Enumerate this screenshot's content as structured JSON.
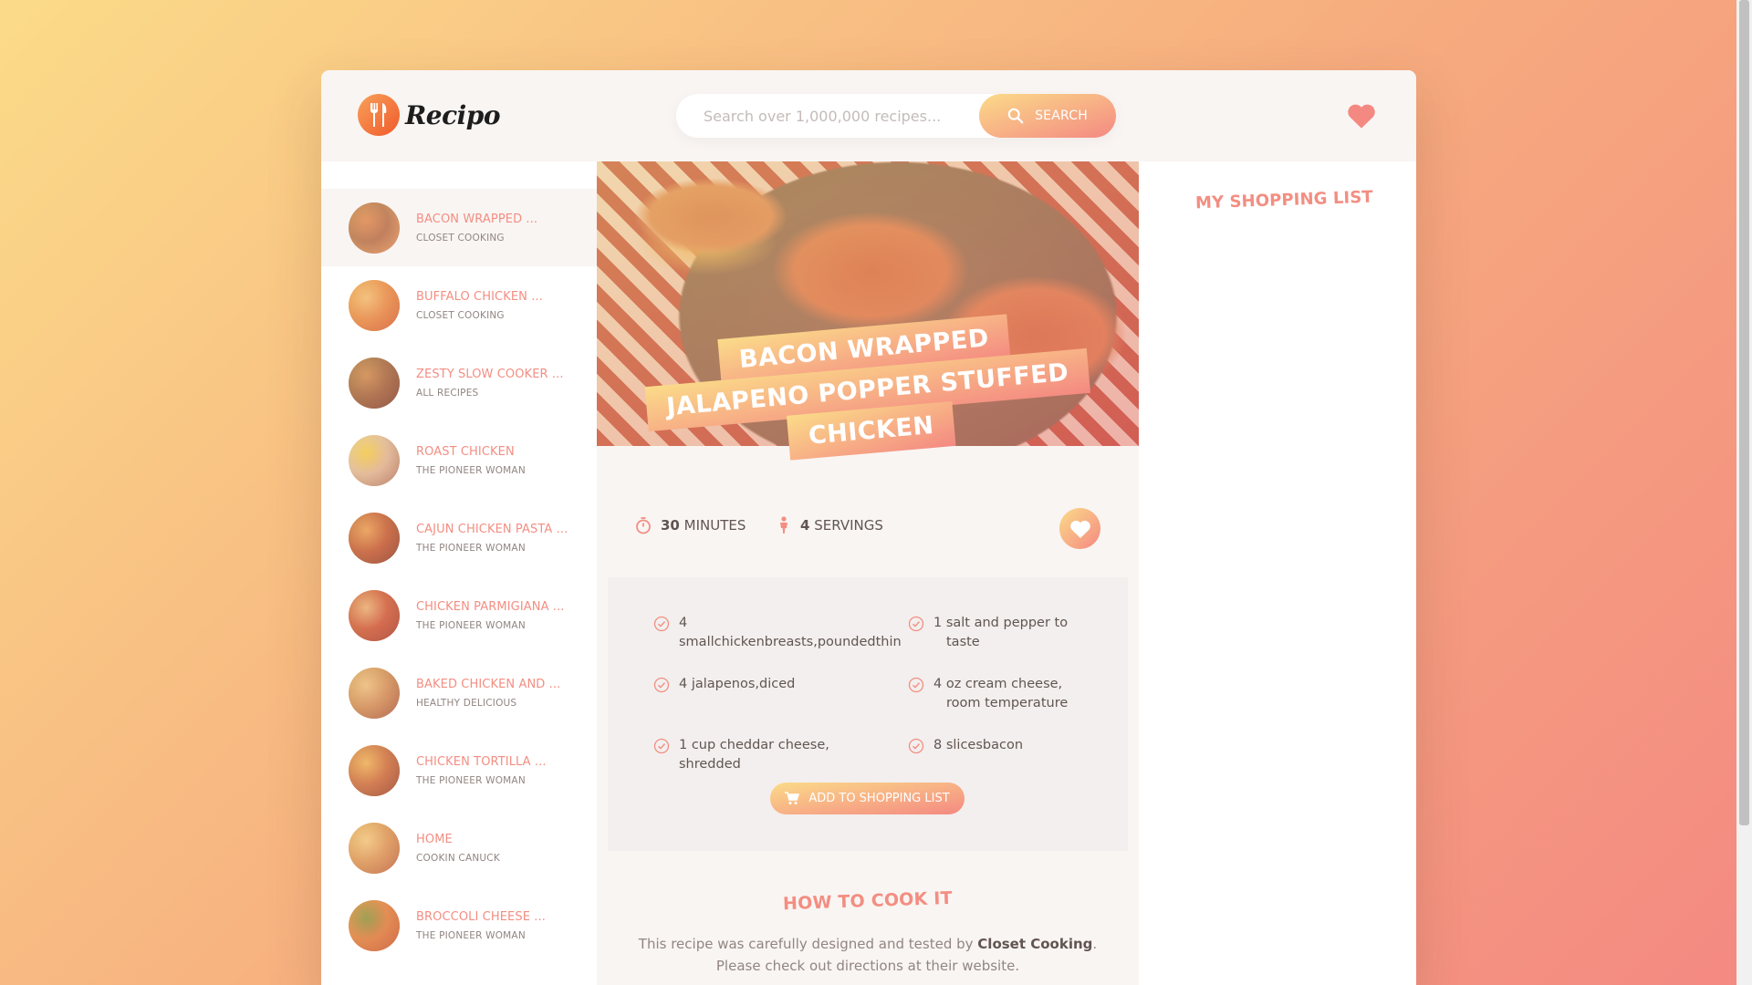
{
  "header": {
    "logo_text": "Recipo",
    "search_placeholder": "Search over 1,000,000 recipes...",
    "search_button": "SEARCH"
  },
  "results": [
    {
      "title": "BACON WRAPPED ...",
      "publisher": "CLOSET COOKING",
      "active": true,
      "colors": [
        "#a46a4a",
        "#d88252",
        "#e6b465"
      ]
    },
    {
      "title": "BUFFALO CHICKEN ...",
      "publisher": "CLOSET COOKING",
      "active": false,
      "colors": [
        "#e38a43",
        "#f0c27a",
        "#c9622d"
      ]
    },
    {
      "title": "ZESTY SLOW COOKER ...",
      "publisher": "ALL RECIPES",
      "active": false,
      "colors": [
        "#8c5a3a",
        "#c2834f",
        "#5e3b29"
      ]
    },
    {
      "title": "ROAST CHICKEN",
      "publisher": "THE PIONEER WOMAN",
      "active": false,
      "colors": [
        "#d9c3a8",
        "#f2d64a",
        "#9b7a5c"
      ]
    },
    {
      "title": "CAJUN CHICKEN PASTA ...",
      "publisher": "THE PIONEER WOMAN",
      "active": false,
      "colors": [
        "#b5502e",
        "#e39a54",
        "#6b3822"
      ]
    },
    {
      "title": "CHICKEN PARMIGIANA ...",
      "publisher": "THE PIONEER WOMAN",
      "active": false,
      "colors": [
        "#c24d33",
        "#e5b07f",
        "#8c3b28"
      ]
    },
    {
      "title": "BAKED CHICKEN AND ...",
      "publisher": "HEALTHY DELICIOUS",
      "active": false,
      "colors": [
        "#c7905a",
        "#e8c58c",
        "#8d5a37"
      ]
    },
    {
      "title": "CHICKEN TORTILLA ...",
      "publisher": "THE PIONEER WOMAN",
      "active": false,
      "colors": [
        "#c0663a",
        "#ebb35a",
        "#7a3f25"
      ]
    },
    {
      "title": "HOME",
      "publisher": "COOKIN CANUCK",
      "active": false,
      "colors": [
        "#d49a5a",
        "#f0d08a",
        "#a9683c"
      ]
    },
    {
      "title": "BROCCOLI CHEESE ...",
      "publisher": "THE PIONEER WOMAN",
      "active": false,
      "colors": [
        "#d87a3a",
        "#6f8f3a",
        "#b95a2a"
      ]
    }
  ],
  "recipe": {
    "title_lines": [
      "BACON WRAPPED",
      "JALAPENO POPPER STUFFED",
      "CHICKEN"
    ],
    "minutes": "30",
    "minutes_label": "MINUTES",
    "servings": "4",
    "servings_label": "SERVINGS",
    "ingredients": [
      {
        "line1": "4 smallchickenbreasts,poundedthin",
        "line2": ""
      },
      {
        "line1": "1 salt and pepper to",
        "line2": "taste"
      },
      {
        "line1": "4 jalapenos,diced",
        "line2": ""
      },
      {
        "line1": "4 oz cream cheese,",
        "line2": "room temperature"
      },
      {
        "line1": "1 cup cheddar cheese, shredded",
        "line2": ""
      },
      {
        "line1": "8 slicesbacon",
        "line2": ""
      }
    ],
    "add_button": "ADD TO SHOPPING LIST",
    "directions_heading": "HOW TO COOK IT",
    "directions_text_1": "This recipe was carefully designed and tested by ",
    "directions_publisher": "Closet Cooking",
    "directions_text_2": ".",
    "directions_text_3": "Please check out directions at their website."
  },
  "shopping": {
    "heading": "MY SHOPPING LIST"
  },
  "colors": {
    "accent": "#f38e82",
    "gradient_start": "#fbdb89",
    "gradient_end": "#f48982",
    "text": "#615551"
  },
  "icons": {
    "logo": "fork-knife-icon",
    "search": "search-icon",
    "likes": "heart-icon",
    "timer": "stopwatch-icon",
    "servings": "person-icon",
    "check": "check-circle-icon",
    "cart": "cart-icon"
  }
}
